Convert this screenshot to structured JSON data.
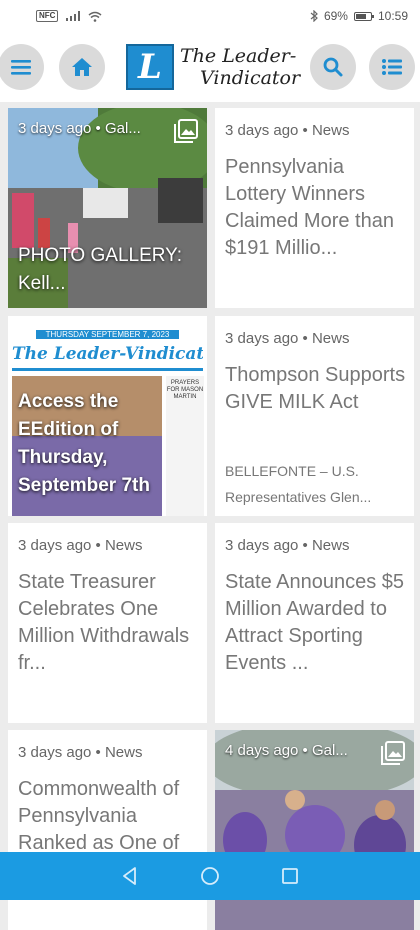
{
  "status_bar": {
    "nfc": "NFC",
    "battery_text": "69%",
    "time": "10:59"
  },
  "header": {
    "logo_letter": "L",
    "logo_line1": "The Leader-",
    "logo_line2": "Vindicator",
    "icons": [
      "menu-icon",
      "home-icon",
      "search-icon",
      "list-icon"
    ]
  },
  "articles": [
    {
      "meta": "3 days ago • Gal...",
      "title": "PHOTO GALLERY: Kell...",
      "type": "gallery"
    },
    {
      "meta": "3 days ago • News",
      "title": "Pennsylvania Lottery Winners Claimed More than $191 Millio..."
    },
    {
      "meta": "",
      "title": "Access the EEdition of Thursday, September 7th",
      "type": "edition",
      "paper_masthead": "The Leader-Vindicator",
      "paper_date": "THURSDAY SEPTEMBER 7, 2023",
      "paper_side": "PRAYERS FOR MASON MARTIN"
    },
    {
      "meta": "3 days ago • News",
      "title": "Thompson Supports GIVE MILK Act",
      "excerpt": "BELLEFONTE – U.S. Representatives Glen..."
    },
    {
      "meta": "3 days ago • News",
      "title": "State Treasurer Celebrates One Million Withdrawals fr..."
    },
    {
      "meta": "3 days ago • News",
      "title": "State Announces $5 Million Awarded to Attract Sporting Events ..."
    },
    {
      "meta": "3 days ago • News",
      "title": "Commonwealth of Pennsylvania Ranked as One of"
    },
    {
      "meta": "4 days ago • Gal...",
      "title": "",
      "type": "gallery"
    }
  ],
  "colors": {
    "accent": "#1b9be2",
    "logo_blue": "#1f8dd0",
    "header_btn": "#dadada",
    "icon_blue": "#1f8dd0"
  }
}
